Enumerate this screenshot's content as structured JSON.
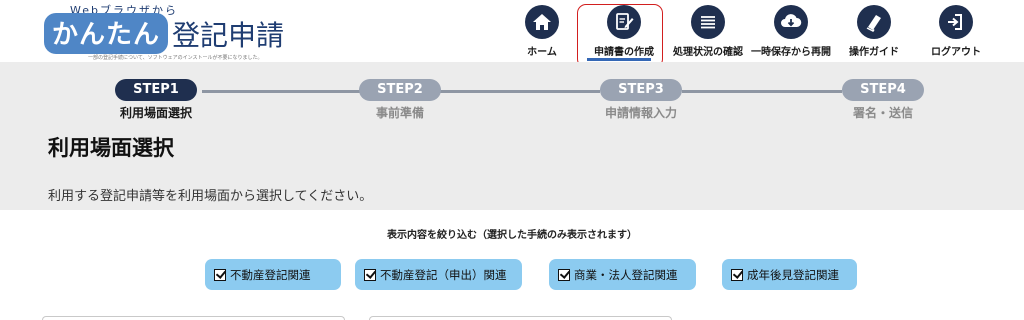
{
  "logo": {
    "top_text": "Webブラウザから",
    "bubble_text": "かんたん",
    "main_text": "登記申請",
    "sub_text": "一部の登記手続について、ソフトウェアのインストールが不要になりました。"
  },
  "nav": {
    "items": [
      {
        "label": "ホーム",
        "icon": "home-icon"
      },
      {
        "label": "申請書の作成",
        "icon": "edit-document-icon",
        "active": true
      },
      {
        "label": "処理状況の確認",
        "icon": "list-icon"
      },
      {
        "label": "一時保存から再開",
        "icon": "cloud-download-icon"
      },
      {
        "label": "操作ガイド",
        "icon": "book-icon"
      },
      {
        "label": "ログアウト",
        "icon": "logout-icon"
      }
    ]
  },
  "steps": [
    {
      "pill": "STEP1",
      "label": "利用場面選択",
      "active": true
    },
    {
      "pill": "STEP2",
      "label": "事前準備",
      "active": false
    },
    {
      "pill": "STEP3",
      "label": "申請情報入力",
      "active": false
    },
    {
      "pill": "STEP4",
      "label": "署名・送信",
      "active": false
    }
  ],
  "page": {
    "title": "利用場面選択",
    "instructions": "利用する登記申請等を利用場面から選択してください。"
  },
  "filter": {
    "caption": "表示内容を絞り込む（選択した手続のみ表示されます）",
    "options": [
      {
        "label": "不動産登記関連",
        "checked": true
      },
      {
        "label": "不動産登記（申出）関連",
        "checked": true
      },
      {
        "label": "商業・法人登記関連",
        "checked": true
      },
      {
        "label": "成年後見登記関連",
        "checked": true
      }
    ]
  },
  "colors": {
    "navy": "#1f2f4f",
    "accent_blue": "#3467b5",
    "filter_bg": "#8ccbf0",
    "band_bg": "#ececec",
    "highlight_red": "#d21f1f"
  }
}
